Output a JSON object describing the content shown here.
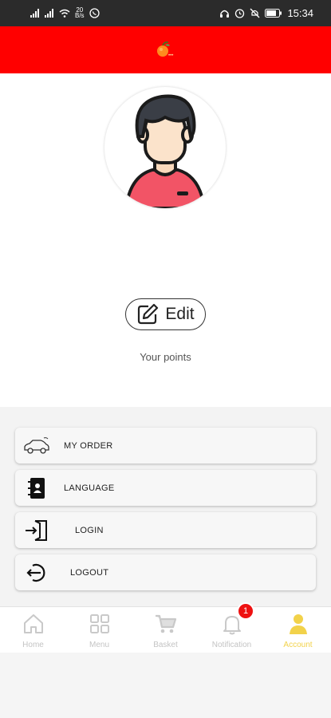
{
  "status_bar": {
    "network_speed_value": "20",
    "network_speed_unit": "B/s",
    "time": "15:34"
  },
  "app_bar": {
    "background": "#ff0000",
    "logo_icon": "fruit-logo-icon"
  },
  "profile": {
    "edit_label": "Edit",
    "points_label": "Your points"
  },
  "menu": {
    "items": [
      {
        "label": "MY ORDER",
        "icon": "car-icon"
      },
      {
        "label": "LANGUAGE",
        "icon": "contact-book-icon"
      },
      {
        "label": "LOGIN",
        "icon": "login-door-icon"
      },
      {
        "label": "LOGOUT",
        "icon": "logout-icon"
      }
    ]
  },
  "tab_bar": {
    "tabs": [
      {
        "label": "Home",
        "icon": "home-icon"
      },
      {
        "label": "Menu",
        "icon": "grid-icon"
      },
      {
        "label": "Basket",
        "icon": "cart-icon"
      },
      {
        "label": "Notification",
        "icon": "bell-icon",
        "badge": "1"
      },
      {
        "label": "Account",
        "icon": "user-icon",
        "active": true
      }
    ],
    "active_color": "#f2d24a"
  }
}
